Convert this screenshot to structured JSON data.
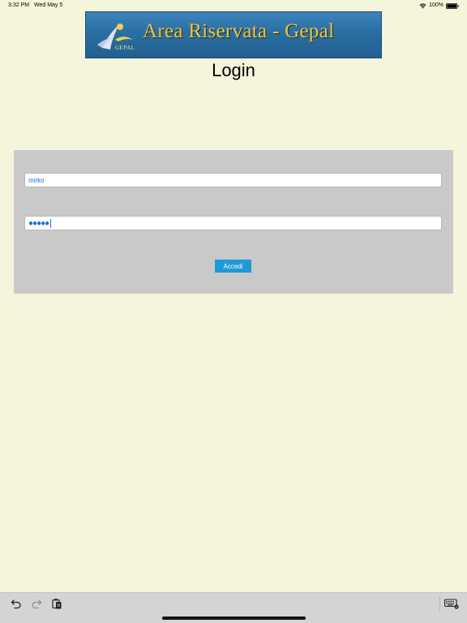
{
  "status_bar": {
    "time": "3:32 PM",
    "date": "Wed May 5",
    "battery_percent": "100%",
    "battery_level": 1.0,
    "icons": [
      "wifi-icon",
      "battery-icon"
    ]
  },
  "banner": {
    "title": "Area Riservata - Gepal",
    "logo_text": "GEPAL"
  },
  "page": {
    "title": "Login"
  },
  "login_form": {
    "username_value": "mirko",
    "password_masked": "●●●●●",
    "submit_label": "Accedi"
  },
  "accessory_bar": {
    "icons": [
      "undo-icon",
      "redo-icon",
      "paste-icon",
      "keyboard-icon"
    ]
  },
  "colors": {
    "background": "#f5f5dc",
    "panel": "#c9c9c9",
    "button": "#1f9ad6",
    "input_text": "#1a6fd8",
    "banner_blue": "#2a6ea3",
    "banner_gold": "#e6c94a"
  }
}
